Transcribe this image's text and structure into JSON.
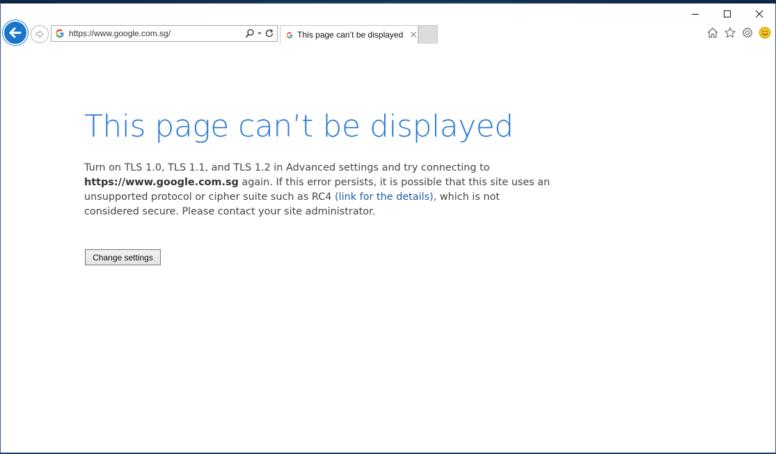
{
  "browser": {
    "address_url": "https://www.google.com.sg/",
    "tab_title": "This page can’t be displayed",
    "tab_close": "×"
  },
  "icons": {
    "back": "arrow-left-icon",
    "forward": "arrow-right-icon",
    "site": "google-g-icon",
    "search": "search-icon",
    "dropdown": "chevron-down-icon",
    "refresh": "refresh-icon",
    "home": "home-icon",
    "favorites": "star-icon",
    "settings": "gear-icon",
    "feedback": "smiley-icon",
    "minimize": "minimize-icon",
    "maximize": "maximize-icon",
    "close": "close-icon"
  },
  "page": {
    "heading": "This page can’t be displayed",
    "para_1": "Turn on TLS 1.0, TLS 1.1, and TLS 1.2 in Advanced settings and try connecting to",
    "para_host": "https://www.google.com.sg",
    "para_2": " again. If this error persists, it is possible that this site uses an unsupported protocol or cipher suite such as RC4 ",
    "link_text": "(link for the details)",
    "para_3": ", which is not considered secure. Please contact your site administrator.",
    "button_label": "Change settings"
  },
  "colors": {
    "heading": "#2b79d3",
    "link": "#1e5ba8",
    "back_button": "#1b76c9",
    "body_text": "#444444"
  }
}
